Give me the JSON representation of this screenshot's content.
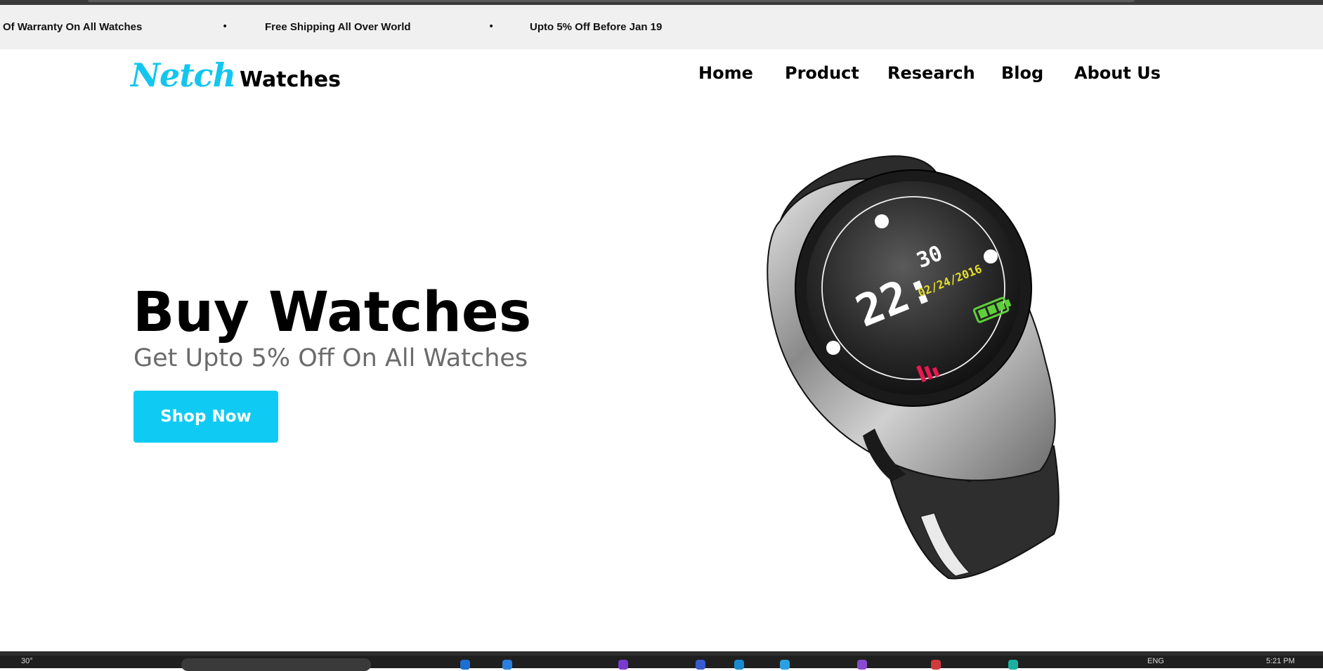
{
  "announcements": [
    "Of Warranty On All Watches",
    "Free Shipping All Over World",
    "Upto 5% Off Before Jan 19"
  ],
  "bullet": "•",
  "logo": {
    "script": "Netch",
    "word": "Watches"
  },
  "nav": [
    "Home",
    "Product",
    "Research",
    "Blog",
    "About Us"
  ],
  "hero": {
    "title": "Buy Watches",
    "subtitle": "Get Upto 5% Off On All Watches",
    "cta": "Shop Now"
  },
  "watch_display": {
    "time_hours": "22:",
    "time_minutes": "30",
    "date": "02/24/2016"
  },
  "taskbar": {
    "weather": "30°",
    "lang": "ENG",
    "clock": "5:21 PM"
  },
  "colors": {
    "accent": "#0fcbf4",
    "logo_script": "#12c6ef",
    "announce_bg": "#f0f0f0"
  }
}
